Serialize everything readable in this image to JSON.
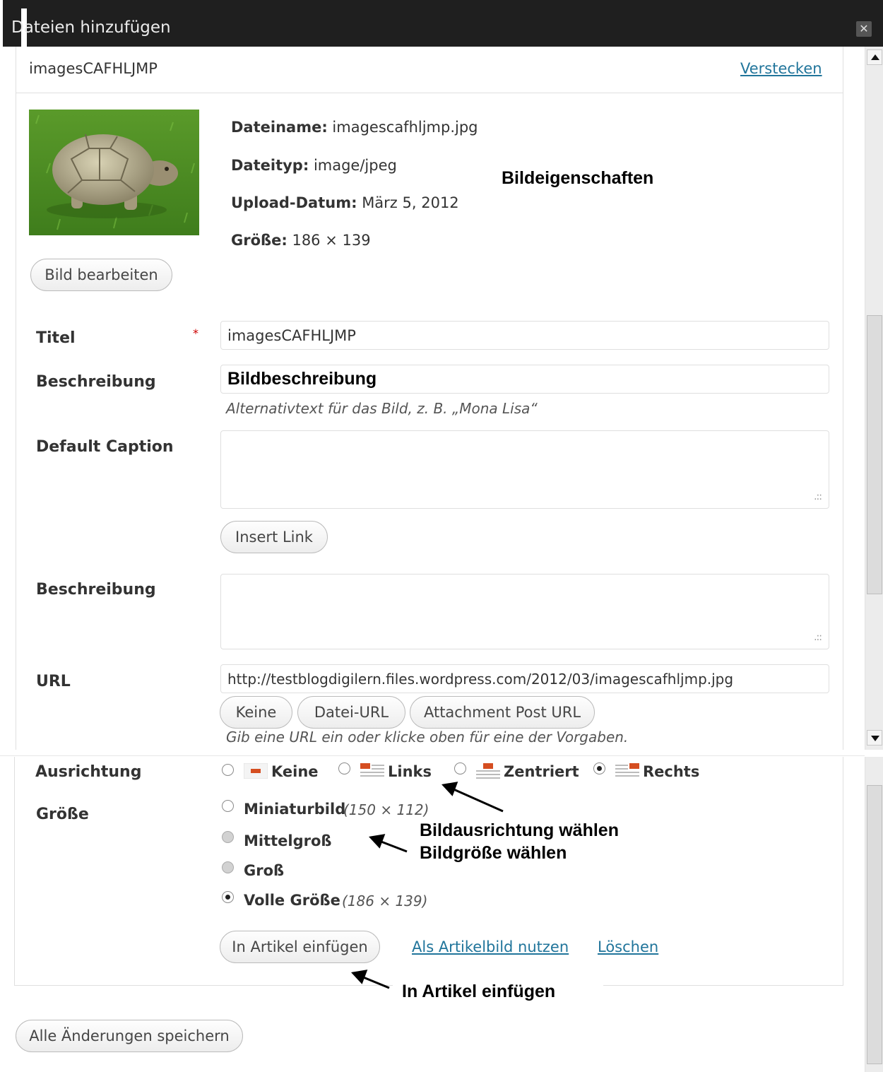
{
  "window": {
    "title": "Dateien hinzufügen",
    "close_glyph": "✕"
  },
  "header": {
    "filename_title": "imagesCAFHLJMP",
    "hide_link": "Verstecken"
  },
  "file_info": {
    "name_label": "Dateiname:",
    "name_value": "imagescafhljmp.jpg",
    "type_label": "Dateityp:",
    "type_value": "image/jpeg",
    "date_label": "Upload-Datum:",
    "date_value": "März 5, 2012",
    "size_label": "Größe:",
    "size_value": "186 × 139",
    "edit_button": "Bild bearbeiten",
    "thumbnail_icon": "tortoise-photo-thumbnail"
  },
  "form": {
    "title_label": "Titel",
    "required_mark": "*",
    "title_value": "imagesCAFHLJMP",
    "alt_label": "Beschreibung",
    "alt_value": "Bildbeschreibung",
    "alt_help": "Alternativtext für das Bild, z. B. „Mona Lisa“",
    "caption_label": "Default Caption",
    "caption_value": "",
    "insert_link_button": "Insert Link",
    "description_label": "Beschreibung",
    "description_value": "",
    "resize_grip": ".::",
    "url_label": "URL",
    "url_value": "http://testblogdigilern.files.wordpress.com/2012/03/imagescafhljmp.jpg",
    "url_buttons": [
      "Keine",
      "Datei-URL",
      "Attachment Post URL"
    ],
    "url_help": "Gib eine URL ein oder klicke oben für eine der Vorgaben.",
    "align_label": "Ausrichtung",
    "align_options": [
      {
        "label": "Keine",
        "checked": false
      },
      {
        "label": "Links",
        "checked": false
      },
      {
        "label": "Zentriert",
        "checked": false
      },
      {
        "label": "Rechts",
        "checked": true
      }
    ],
    "size_label": "Größe",
    "size_options": [
      {
        "label": "Miniaturbild",
        "dims": "(150 × 112)",
        "checked": false,
        "disabled": false
      },
      {
        "label": "Mittelgroß",
        "dims": "",
        "checked": false,
        "disabled": true
      },
      {
        "label": "Groß",
        "dims": "",
        "checked": false,
        "disabled": true
      },
      {
        "label": "Volle Größe",
        "dims": "(186 × 139)",
        "checked": true,
        "disabled": false
      }
    ]
  },
  "actions": {
    "insert_button": "In Artikel einfügen",
    "featured_link": "Als Artikelbild nutzen",
    "delete_link": "Löschen",
    "save_all_button": "Alle Änderungen speichern"
  },
  "annotations": {
    "properties": "Bildeigenschaften",
    "alignment": "Bildausrichtung wählen",
    "size": "Bildgröße wählen",
    "insert": "In Artikel einfügen"
  },
  "colors": {
    "titlebar": "#1f1f1f",
    "link": "#21759b",
    "required": "#cc0000",
    "align_icon_accent": "#d54e21"
  }
}
